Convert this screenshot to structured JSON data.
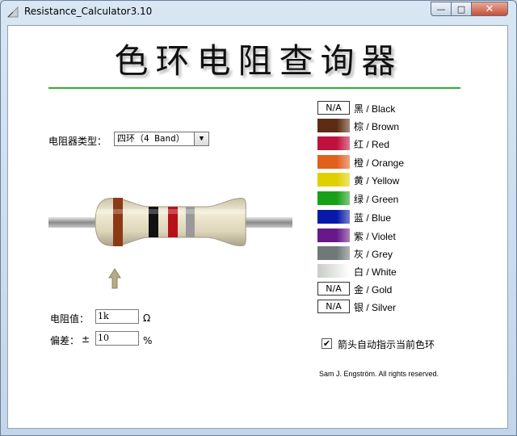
{
  "window": {
    "title": "Resistance_Calculator3.10",
    "min_label": "—",
    "max_label": "□",
    "close_label": "✕"
  },
  "header": {
    "title": "色环电阻查询器"
  },
  "type": {
    "label": "电阻器类型：",
    "selected": "四环（4 Band）"
  },
  "resistance": {
    "label": "电阻值：",
    "value": "1k",
    "unit": "Ω"
  },
  "tolerance": {
    "label": "偏差：",
    "prefix": "±",
    "value": "10",
    "unit": "%"
  },
  "colors": [
    {
      "name": "黑 / Black",
      "hex": "#000000",
      "swatch_text": "N/A"
    },
    {
      "name": "棕 / Brown",
      "hex": "#5c2c14",
      "swatch_text": ""
    },
    {
      "name": "红 / Red",
      "hex": "#c0103c",
      "swatch_text": ""
    },
    {
      "name": "橙 / Orange",
      "hex": "#e0601c",
      "swatch_text": ""
    },
    {
      "name": "黄 / Yellow",
      "hex": "#e0d000",
      "swatch_text": ""
    },
    {
      "name": "绿 / Green",
      "hex": "#18a018",
      "swatch_text": ""
    },
    {
      "name": "蓝 / Blue",
      "hex": "#0818a8",
      "swatch_text": ""
    },
    {
      "name": "紫 / Violet",
      "hex": "#681888",
      "swatch_text": ""
    },
    {
      "name": "灰 / Grey",
      "hex": "#707878",
      "swatch_text": ""
    },
    {
      "name": "白 / White",
      "hex": "#f2f4f2",
      "swatch_text": ""
    },
    {
      "name": "金 / Gold",
      "hex": "#c9a13a",
      "swatch_text": "N/A"
    },
    {
      "name": "银 / Silver",
      "hex": "#c0c0c0",
      "swatch_text": "N/A"
    }
  ],
  "bands": [
    {
      "name": "band-1",
      "hex": "#8b3a18"
    },
    {
      "name": "band-2",
      "hex": "#111111"
    },
    {
      "name": "band-3",
      "hex": "#b81018"
    },
    {
      "name": "band-4",
      "hex": "#9a9a9a"
    }
  ],
  "auto_arrow": {
    "label": "箭头自动指示当前色环",
    "checked": true,
    "check_mark": "✔"
  },
  "footer": {
    "copyright": "Sam J. Engström. All rights reserved."
  }
}
